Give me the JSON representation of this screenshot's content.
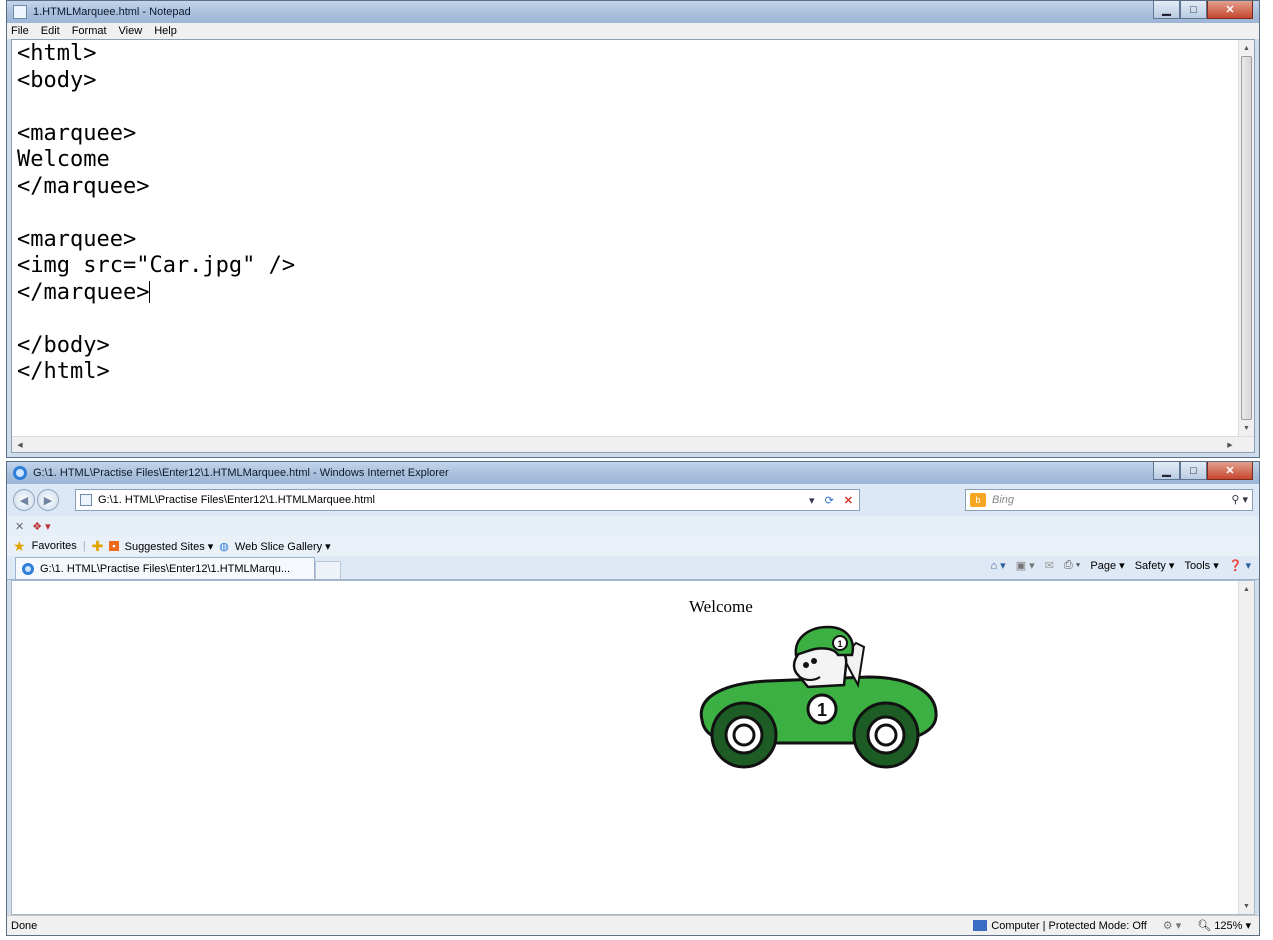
{
  "notepad": {
    "title": "1.HTMLMarquee.html - Notepad",
    "menu": [
      "File",
      "Edit",
      "Format",
      "View",
      "Help"
    ],
    "code_lines": [
      "<html>",
      "<body>",
      "",
      "<marquee>",
      "Welcome",
      "</marquee>",
      "",
      "<marquee>",
      "<img src=\"Car.jpg\" />",
      "</marquee>",
      "",
      "</body>",
      "</html>"
    ],
    "caret_line_index": 9
  },
  "browser": {
    "title": "G:\\1. HTML\\Practise Files\\Enter12\\1.HTMLMarquee.html - Windows Internet Explorer",
    "address": "G:\\1. HTML\\Practise Files\\Enter12\\1.HTMLMarquee.html",
    "search_placeholder": "Bing",
    "favorites_label": "Favorites",
    "suggested_sites": "Suggested Sites ▾",
    "web_slice_gallery": "Web Slice Gallery ▾",
    "tab_title": "G:\\1. HTML\\Practise Files\\Enter12\\1.HTMLMarqu...",
    "command_bar": {
      "page": "Page ▾",
      "safety": "Safety ▾",
      "tools": "Tools ▾"
    },
    "page_content": {
      "marquee_text": "Welcome",
      "car_number": "1"
    },
    "status": {
      "text": "Done",
      "zone": "Computer | Protected Mode: Off",
      "zoom": "125%"
    }
  },
  "colors": {
    "titlebar": "#a9c0dc",
    "close_button": "#c6462e",
    "car_body": "#3cb043",
    "car_dark": "#1d5c24"
  }
}
